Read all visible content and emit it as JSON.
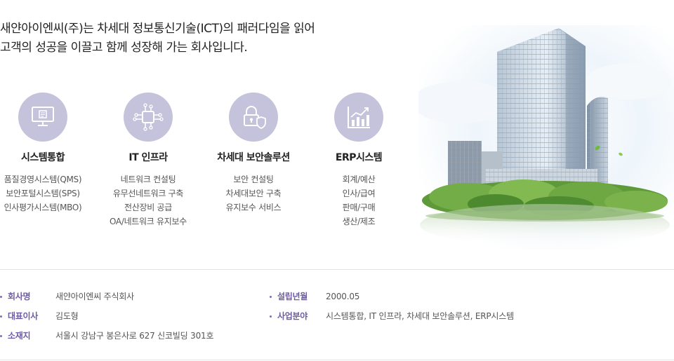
{
  "headline": {
    "line1": "새얀아이엔씨(주)는 차세대 정보통신기술(ICT)의 패러다임을 읽어",
    "line2": "고객의 성공을 이끌고 함께 성장해 가는 회사입니다."
  },
  "services": [
    {
      "icon": "monitor-icon",
      "title": "시스템통합",
      "items": [
        "품질경영시스템(QMS)",
        "보안포털시스템(SPS)",
        "인사평가시스템(MBO)"
      ]
    },
    {
      "icon": "circuit-icon",
      "title": "IT 인프라",
      "items": [
        "네트워크 컨설팅",
        "유무선네트워크 구축",
        "전산장비 공급",
        "OA/네트워크 유지보수"
      ]
    },
    {
      "icon": "lock-shield-icon",
      "title": "차세대 보안솔루션",
      "items": [
        "보안 컨설팅",
        "차세대보안 구축",
        "유지보수 서비스"
      ]
    },
    {
      "icon": "bar-chart-icon",
      "title": "ERP시스템",
      "items": [
        "회계/예산",
        "인사/급여",
        "판매/구매",
        "생산/제조"
      ]
    }
  ],
  "company": {
    "name_label": "회사명",
    "name_value": "새얀아이엔씨 주식회사",
    "ceo_label": "대표이사",
    "ceo_value": "김도형",
    "address_label": "소재지",
    "address_value": "서울시 강남구 봉은사로 627 신코빌딩 301호",
    "founded_label": "설립년월",
    "founded_value": "2000.05",
    "business_label": "사업분야",
    "business_value": "시스템통합, IT 인프라, 차세대 보안솔루션, ERP시스템"
  },
  "colors": {
    "accent": "#6f5ba5",
    "icon_circle": "#c5c3dc",
    "border": "#e2e2e2"
  }
}
